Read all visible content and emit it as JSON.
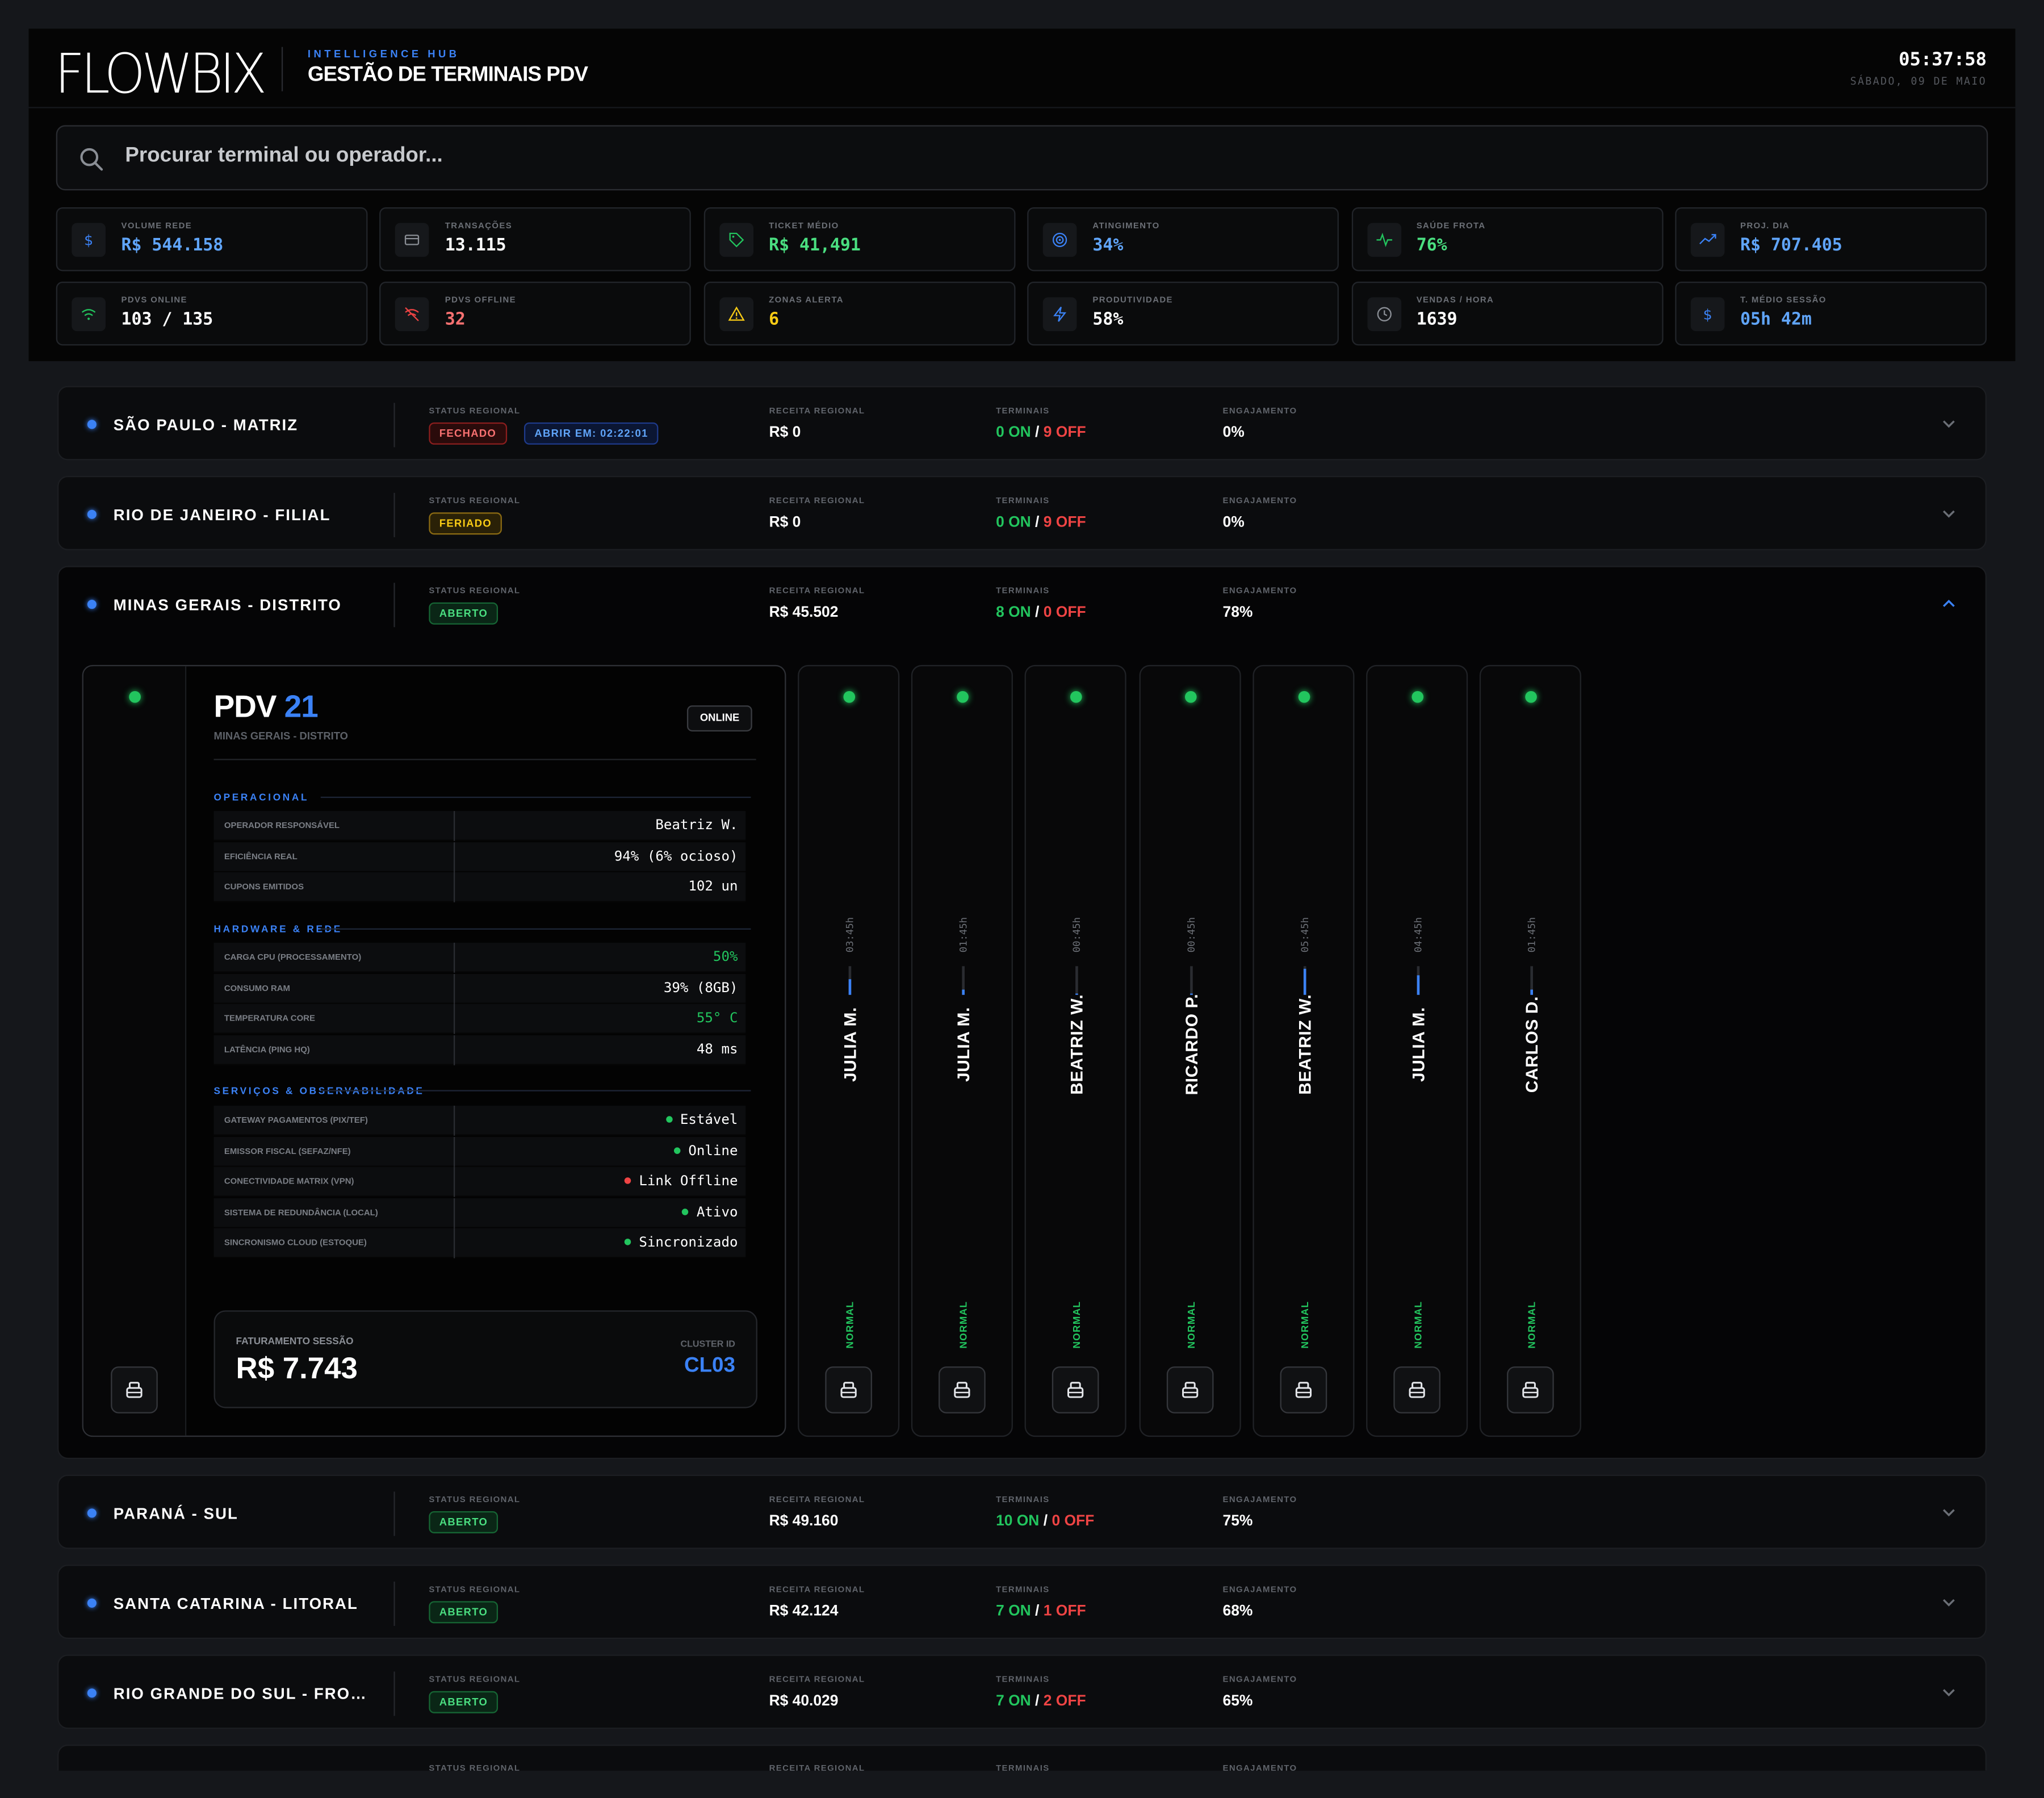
{
  "header": {
    "logo": "FLOWBIX",
    "kicker": "INTELLIGENCE HUB",
    "title": "GESTÃO DE TERMINAIS PDV",
    "clock": "05:37:58",
    "date": "SÁBADO, 09 DE MAIO"
  },
  "search": {
    "placeholder": "Procurar terminal ou operador..."
  },
  "kpis": [
    {
      "label": "VOLUME REDE",
      "value": "R$ 544.158",
      "icon": "dollar-icon",
      "color": "#60a5fa"
    },
    {
      "label": "TRANSAÇÕES",
      "value": "13.115",
      "icon": "card-icon",
      "color": "#ffffff"
    },
    {
      "label": "TICKET MÉDIO",
      "value": "R$ 41,491",
      "icon": "tag-icon",
      "color": "#4ade80"
    },
    {
      "label": "ATINGIMENTO",
      "value": "34%",
      "icon": "target-icon",
      "color": "#60a5fa"
    },
    {
      "label": "SAÚDE FROTA",
      "value": "76%",
      "icon": "pulse-icon",
      "color": "#4ade80"
    },
    {
      "label": "PROJ. DIA",
      "value": "R$ 707.405",
      "icon": "trend-icon",
      "color": "#60a5fa"
    },
    {
      "label": "PDVS ONLINE",
      "value": "103 / 135",
      "icon": "wifi-icon",
      "color": "#ffffff"
    },
    {
      "label": "PDVS OFFLINE",
      "value": "32",
      "icon": "wifi-off-icon",
      "color": "#f87171"
    },
    {
      "label": "ZONAS ALERTA",
      "value": "6",
      "icon": "alert-icon",
      "color": "#facc15"
    },
    {
      "label": "PRODUTIVIDADE",
      "value": "58%",
      "icon": "bolt-icon",
      "color": "#ffffff"
    },
    {
      "label": "VENDAS / HORA",
      "value": "1639",
      "icon": "clock-icon",
      "color": "#ffffff"
    },
    {
      "label": "T. MÉDIO SESSÃO",
      "value": "05h 42m",
      "icon": "dollar-icon",
      "color": "#60a5fa"
    }
  ],
  "labels": {
    "status": "STATUS REGIONAL",
    "revenue": "RECEITA REGIONAL",
    "terminals": "TERMINAIS",
    "engagement": "ENGAJAMENTO"
  },
  "regions": [
    {
      "name": "SÃO PAULO - MATRIZ",
      "status": "FECHADO",
      "extra": "ABRIR EM: 02:22:01",
      "revenue": "R$ 0",
      "on": "0 ON",
      "off": "9 OFF",
      "engagement": "0%"
    },
    {
      "name": "RIO DE JANEIRO - FILIAL",
      "status": "FERIADO",
      "revenue": "R$ 0",
      "on": "0 ON",
      "off": "9 OFF",
      "engagement": "0%"
    },
    {
      "name": "MINAS GERAIS - DISTRITO",
      "status": "ABERTO",
      "revenue": "R$ 45.502",
      "on": "8 ON",
      "off": "0 OFF",
      "engagement": "78%"
    },
    {
      "name": "PARANÁ - SUL",
      "status": "ABERTO",
      "revenue": "R$ 49.160",
      "on": "10 ON",
      "off": "0 OFF",
      "engagement": "75%"
    },
    {
      "name": "SANTA CATARINA - LITORAL",
      "status": "ABERTO",
      "revenue": "R$ 42.124",
      "on": "7 ON",
      "off": "1 OFF",
      "engagement": "68%"
    },
    {
      "name": "RIO GRANDE DO SUL - FRONT...",
      "status": "ABERTO",
      "revenue": "R$ 40.029",
      "on": "7 ON",
      "off": "2 OFF",
      "engagement": "65%"
    }
  ],
  "slash": "/",
  "detail": {
    "pdv_prefix": "PDV",
    "pdv_num": "21",
    "region": "MINAS GERAIS - DISTRITO",
    "status": "ONLINE",
    "sec_operacional": "OPERACIONAL",
    "sec_hardware": "HARDWARE & REDE",
    "sec_servicos": "SERVIÇOS & OBSERVABILIDADE",
    "operacional": [
      {
        "k": "OPERADOR RESPONSÁVEL",
        "v": "Beatriz W."
      },
      {
        "k": "EFICIÊNCIA REAL",
        "v": "94% (6% ocioso)"
      },
      {
        "k": "CUPONS EMITIDOS",
        "v": "102 un"
      }
    ],
    "hardware": [
      {
        "k": "CARGA CPU (PROCESSAMENTO)",
        "v": "50%",
        "color": "#22c55e"
      },
      {
        "k": "CONSUMO RAM",
        "v": "39% (8GB)",
        "color": "#ffffff"
      },
      {
        "k": "TEMPERATURA CORE",
        "v": "55° C",
        "color": "#22c55e"
      },
      {
        "k": "LATÊNCIA (PING HQ)",
        "v": "48 ms",
        "color": "#ffffff"
      }
    ],
    "servicos": [
      {
        "k": "GATEWAY PAGAMENTOS (PIX/TEF)",
        "v": "Estável",
        "dot": "#22c55e"
      },
      {
        "k": "EMISSOR FISCAL (SEFAZ/NFE)",
        "v": "Online",
        "dot": "#22c55e"
      },
      {
        "k": "CONECTIVIDADE MATRIX (VPN)",
        "v": "Link Offline",
        "dot": "#ef4444"
      },
      {
        "k": "SISTEMA DE REDUNDÂNCIA (LOCAL)",
        "v": "Ativo",
        "dot": "#22c55e"
      },
      {
        "k": "SINCRONISMO CLOUD (ESTOQUE)",
        "v": "Sincronizado",
        "dot": "#22c55e"
      }
    ],
    "fat_label": "FATURAMENTO SESSÃO",
    "fat_value": "R$ 7.743",
    "cluster_label": "CLUSTER ID",
    "cluster_value": "CL03"
  },
  "terminals": [
    {
      "operator": "JULIA M.",
      "time": "03:45h",
      "fill": 0.55,
      "status": "NORMAL"
    },
    {
      "operator": "JULIA M.",
      "time": "01:45h",
      "fill": 0.2,
      "status": "NORMAL"
    },
    {
      "operator": "BEATRIZ W.",
      "time": "00:45h",
      "fill": 0.05,
      "status": "NORMAL"
    },
    {
      "operator": "RICARDO P.",
      "time": "00:45h",
      "fill": 0.05,
      "status": "NORMAL"
    },
    {
      "operator": "BEATRIZ W.",
      "time": "05:45h",
      "fill": 0.9,
      "status": "NORMAL"
    },
    {
      "operator": "JULIA M.",
      "time": "04:45h",
      "fill": 0.7,
      "status": "NORMAL"
    },
    {
      "operator": "CARLOS D.",
      "time": "01:45h",
      "fill": 0.2,
      "status": "NORMAL"
    }
  ]
}
